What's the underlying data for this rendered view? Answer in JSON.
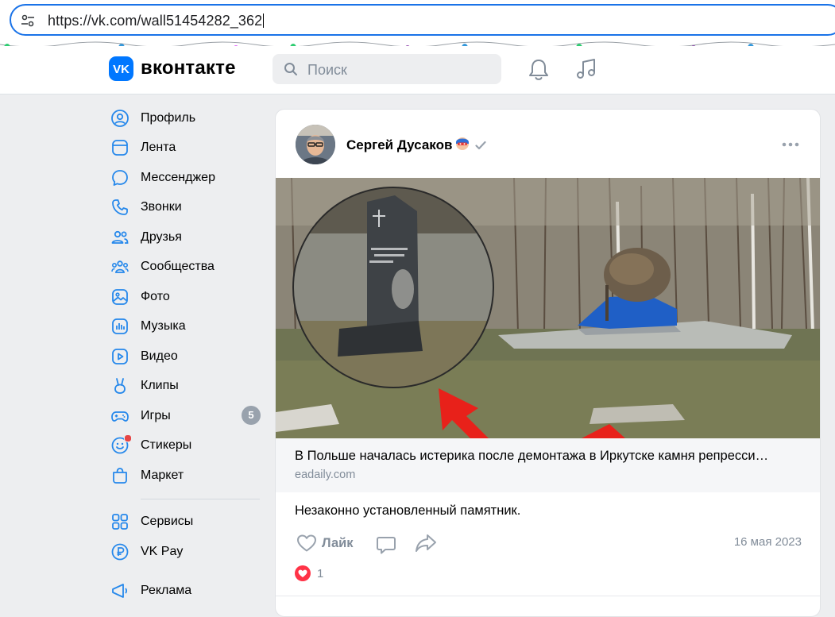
{
  "browser": {
    "url": "https://vk.com/wall51454282_362"
  },
  "header": {
    "logo_text": "вконтакте",
    "search_placeholder": "Поиск",
    "accent_color": "#0077ff"
  },
  "sidebar": {
    "items": [
      {
        "label": "Профиль",
        "icon": "profile-icon"
      },
      {
        "label": "Лента",
        "icon": "feed-icon"
      },
      {
        "label": "Мессенджер",
        "icon": "messenger-icon"
      },
      {
        "label": "Звонки",
        "icon": "phone-icon"
      },
      {
        "label": "Друзья",
        "icon": "friends-icon"
      },
      {
        "label": "Сообщества",
        "icon": "communities-icon"
      },
      {
        "label": "Фото",
        "icon": "photo-icon"
      },
      {
        "label": "Музыка",
        "icon": "music-icon"
      },
      {
        "label": "Видео",
        "icon": "video-icon"
      },
      {
        "label": "Клипы",
        "icon": "clips-icon"
      },
      {
        "label": "Игры",
        "icon": "games-icon",
        "badge": "5"
      },
      {
        "label": "Стикеры",
        "icon": "stickers-icon"
      },
      {
        "label": "Маркет",
        "icon": "market-icon"
      }
    ],
    "secondary": [
      {
        "label": "Сервисы",
        "icon": "services-icon"
      },
      {
        "label": "VK Pay",
        "icon": "vkpay-icon"
      },
      {
        "label": "Реклама",
        "icon": "ads-icon"
      }
    ]
  },
  "post": {
    "author": "Сергей Дусаков",
    "link_title": "В Польше началась истерика после демонтажа в Иркутске камня репресси…",
    "link_domain": "eadaily.com",
    "text": "Незаконно установленный памятник.",
    "like_label": "Лайк",
    "date": "16 мая 2023",
    "reaction_count": "1"
  }
}
